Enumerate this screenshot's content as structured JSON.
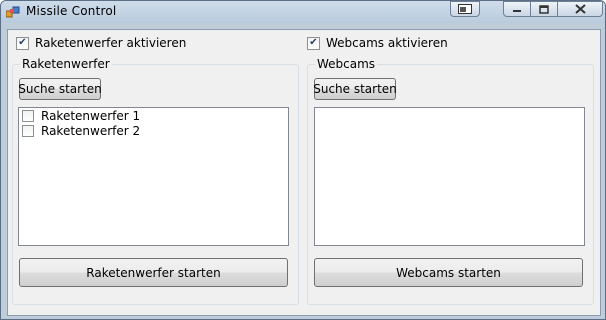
{
  "window": {
    "title": "Missile Control"
  },
  "options": {
    "launcher_enable_label": "Raketenwerfer aktivieren",
    "launcher_enable_checked": true,
    "webcam_enable_label": "Webcams aktivieren",
    "webcam_enable_checked": true
  },
  "launcher_group": {
    "title": "Raketenwerfer",
    "search_label": "Suche starten",
    "items": [
      {
        "label": "Raketenwerfer 1",
        "checked": false
      },
      {
        "label": "Raketenwerfer 2",
        "checked": false
      }
    ],
    "start_label": "Raketenwerfer starten"
  },
  "webcam_group": {
    "title": "Webcams",
    "search_label": "Suche starten",
    "items": [],
    "start_label": "Webcams starten"
  }
}
